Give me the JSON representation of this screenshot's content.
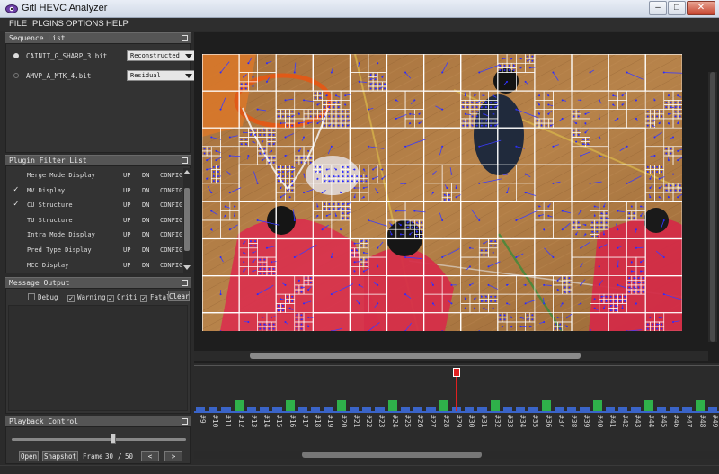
{
  "window": {
    "title": "Gitl HEVC Analyzer",
    "buttons": [
      "–",
      "□",
      "✕"
    ]
  },
  "menu": [
    "FILE",
    "PLGINS",
    "OPTIONS",
    "HELP"
  ],
  "sequence_list": {
    "title": "Sequence List",
    "items": [
      {
        "name": "CAINIT_G_SHARP_3.bit",
        "mode": "Reconstructed",
        "selected": true
      },
      {
        "name": "AMVP_A_MTK_4.bit",
        "mode": "Residual",
        "selected": false
      }
    ]
  },
  "plugin_filter": {
    "title": "Plugin Filter List",
    "up": "UP",
    "dn": "DN",
    "config": "CONFIG",
    "items": [
      {
        "name": "Merge Mode Display",
        "checked": false
      },
      {
        "name": "MV Display",
        "checked": true
      },
      {
        "name": "CU Structure",
        "checked": true
      },
      {
        "name": "TU Structure",
        "checked": false
      },
      {
        "name": "Intra Mode Display",
        "checked": false
      },
      {
        "name": "Pred Type Display",
        "checked": false
      },
      {
        "name": "MCC Display",
        "checked": false
      }
    ]
  },
  "message_output": {
    "title": "Message Output",
    "filters": [
      {
        "label": "Debug",
        "checked": false
      },
      {
        "label": "Warning",
        "checked": true
      },
      {
        "label": "Criti",
        "checked": true
      },
      {
        "label": "Fatal",
        "checked": true
      }
    ],
    "clear": "Clear"
  },
  "playback": {
    "title": "Playback Control",
    "open": "Open",
    "snapshot": "Snapshot",
    "frame_label": "Frame",
    "frame_current": "30",
    "frame_sep": "/",
    "frame_total": "50",
    "prev": "<",
    "next": ">",
    "slider_value": 0.58
  },
  "timeline": {
    "frames": [
      "#9",
      "#10",
      "#11",
      "#12",
      "#13",
      "#14",
      "#15",
      "#16",
      "#17",
      "#18",
      "#19",
      "#20",
      "#21",
      "#22",
      "#23",
      "#24",
      "#25",
      "#26",
      "#27",
      "#28",
      "#29",
      "#30",
      "#31",
      "#32",
      "#33",
      "#34",
      "#35",
      "#36",
      "#37",
      "#38",
      "#39",
      "#40",
      "#41",
      "#42",
      "#43",
      "#44",
      "#45",
      "#46",
      "#47",
      "#48",
      "#49"
    ],
    "current_frame": "#29",
    "i_frames": [
      "#12",
      "#16",
      "#20",
      "#24",
      "#28",
      "#32",
      "#36",
      "#40",
      "#44",
      "#48"
    ],
    "colors": {
      "i_frame": "#2fb14a",
      "p_frame": "#3a64c8",
      "cursor": "#e02020"
    }
  },
  "icons": [
    "eye-icon",
    "float-icon",
    "dropdown-arrow-icon",
    "check-icon"
  ]
}
